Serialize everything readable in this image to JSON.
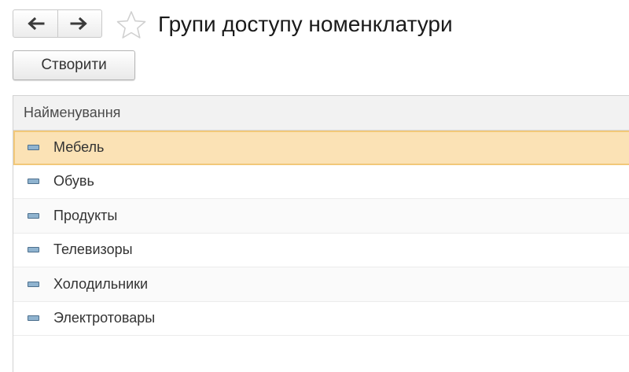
{
  "header": {
    "title": "Групи доступу номенклатури"
  },
  "toolbar": {
    "create_label": "Створити"
  },
  "table": {
    "columns": [
      "Найменування"
    ],
    "rows": [
      {
        "label": "Мебель",
        "selected": true
      },
      {
        "label": "Обувь",
        "selected": false
      },
      {
        "label": "Продукты",
        "selected": false
      },
      {
        "label": "Телевизоры",
        "selected": false
      },
      {
        "label": "Холодильники",
        "selected": false
      },
      {
        "label": "Электротовары",
        "selected": false
      }
    ]
  },
  "icons": {
    "back": "arrow-left-icon",
    "forward": "arrow-right-icon",
    "favorite": "star-icon",
    "row": "catalog-item-icon"
  },
  "colors": {
    "selected_row": "#fbe2b5",
    "selected_border": "#f2c879",
    "row_icon": "#8fb3cf"
  }
}
